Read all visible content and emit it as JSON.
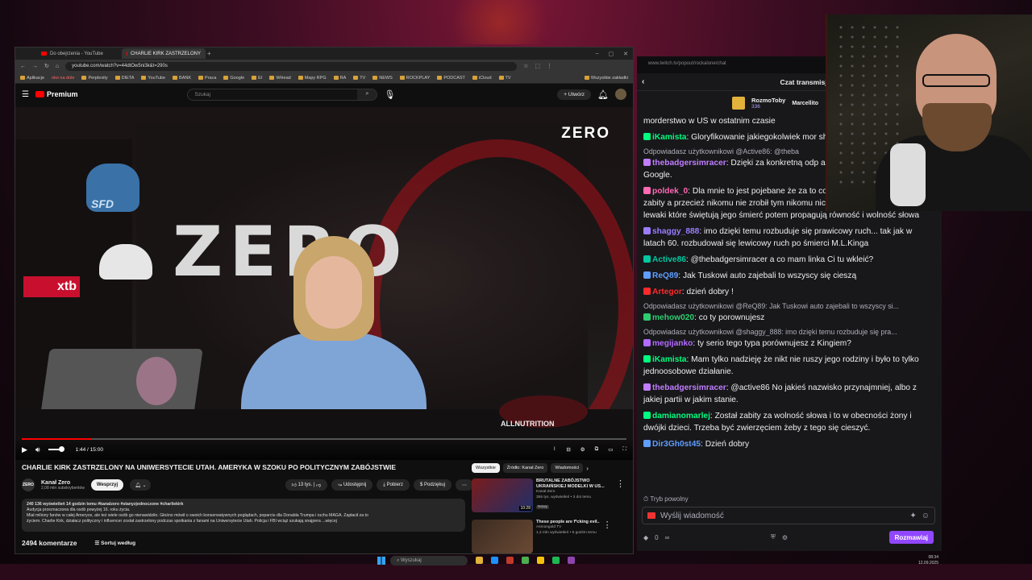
{
  "browser": {
    "tabs": [
      {
        "label": "Do obejrzenia - YouTube",
        "active": false
      },
      {
        "label": "CHARLIE KIRK ZASTRZELONY",
        "active": true
      }
    ],
    "url": "youtube.com/watch?v=44dtOw5ni3k&t=290s",
    "bookmarks": [
      "Aplikacje",
      "oko na dole",
      "Perplexity",
      "DIETA",
      "YouTube",
      "BANK",
      "Praca",
      "Google",
      "EI",
      "WHead",
      "Mapy RPG",
      "RA",
      "TV",
      "NEWS",
      "ROCKPLAY",
      "PODCAST",
      "iCloud",
      "TV"
    ],
    "bookmarks_all": "Wszystkie zakładki"
  },
  "youtube": {
    "brand": "Premium",
    "search_placeholder": "Szukaj",
    "create_label": "Utwórz",
    "video": {
      "time": "1:44 / 15:00",
      "progress_fraction": 0.1156,
      "overlay_logo": "ZERO",
      "sponsor": "xtb",
      "merch": "ALLNUTRITION"
    },
    "title": "CHARLIE KIRK ZASTRZELONY NA UNIWERSYTECIE UTAH. AMERYKA W SZOKU PO POLITYCZNYM ZABÓJSTWIE",
    "channel": {
      "name": "Kanał Zero",
      "subs": "2,08 mln subskrybentów",
      "avatar_text": "ZERO"
    },
    "join_label": "Wesprzyj",
    "actions": {
      "likes": "13 tys.",
      "share": "Udostępnij",
      "download": "Pobierz",
      "thanks": "Podziękuj"
    },
    "description": {
      "stats": "240 136 wyświetleń  14 godzin temu  #kanalzero #stanyzjednoczone #charliekirk",
      "line1": "Audycja przeznaczona dla osób powyżej 16. roku życia.",
      "line2": "Miał miliony fanów w całej Ameryce, ale też wiele osób go nienawidziło. Głośno mówił o swoich konserwatywnych poglądach, poparciu dla Donalda Trumpa i ruchu MAGA. Zapłacił za to",
      "line3": "życiem. Charlie Kirk, działacz polityczny i influencer został zastrzelony podczas spotkania z fanami na Uniwersytecie Utah. Policja i FBI wciąż szukają snajpera  ...więcej"
    },
    "comments_count": "2494 komentarze",
    "sort_label": "Sortuj według",
    "chips": [
      "Wszystkie",
      "Źródło: Kanał Zero",
      "Wiadomości"
    ],
    "recommendations": [
      {
        "title": "BRUTALNE ZABÓJSTWO UKRAIŃSKIEJ MODELKI W US...",
        "channel": "Kanał Zero",
        "meta": "355 tys. wyświetleń • 3 dni temu",
        "badge": "Nowy",
        "duration": "10:28"
      },
      {
        "title": "These people are f*cking evil..",
        "channel": "Asmongold TV",
        "meta": "1,2 mln wyświetleń • 6 godzin temu",
        "badge": "",
        "duration": ""
      }
    ]
  },
  "chat": {
    "url": "www.twitch.tv/popout/rockalone/chat",
    "header": "Czat transmisji",
    "pinned": {
      "name": "RozmoToby",
      "count": "336",
      "second": "Marcellito"
    },
    "messages": [
      {
        "reply": "",
        "user": "",
        "color": "#efeff1",
        "text": "morderstwo w US w ostatnim czasie"
      },
      {
        "reply": "",
        "user": "iKamista",
        "color": "#00ff7f",
        "text": "Gloryfikowanie jakiegokolwiek mor sh."
      },
      {
        "reply": "Odpowiadasz użytkownikowi @Active86: @theba",
        "user": "thebadgersimracer",
        "color": "#c17dff",
        "text": "Dzięki za konkretną odp argument. Wpisz sobie w Google."
      },
      {
        "reply": "",
        "user": "poldek_0",
        "color": "#ff69b4",
        "text": "Dla mnie to jest pojebane że za to co mówił i za to co myśli został zabity a przecież nikomu nie zrobił tym nikomu nic złego. A najlepsze jest to, że lewaki które świętują jego śmierć potem propagują równość i wolność słowa"
      },
      {
        "reply": "",
        "user": "shaggy_888",
        "color": "#9a7dff",
        "text": "imo dzięki temu rozbuduje się prawicowy ruch... tak jak w latach 60. rozbudował się lewicowy ruch po śmierci M.L.Kinga"
      },
      {
        "reply": "",
        "user": "Active86",
        "color": "#00c8a0",
        "text": "@thebadgersimracer a co mam linka Ci tu wkleić?"
      },
      {
        "reply": "",
        "user": "ReQ89",
        "color": "#5f9eff",
        "text": "Jak Tuskowi auto zajebali to wszyscy się cieszą"
      },
      {
        "reply": "",
        "user": "Artegor",
        "color": "#ff2a2a",
        "text": "dzień dobry !"
      },
      {
        "reply": "Odpowiadasz użytkownikowi @ReQ89: Jak Tuskowi auto zajebali to wszyscy si...",
        "user": "mehow020",
        "color": "#2ecc71",
        "text": "co ty porownujesz"
      },
      {
        "reply": "Odpowiadasz użytkownikowi @shaggy_888: imo dzięki temu rozbuduje się pra...",
        "user": "megijanko",
        "color": "#b36bff",
        "text": "ty serio tego typa porównujesz z Kingiem?"
      },
      {
        "reply": "",
        "user": "iKamista",
        "color": "#00ff7f",
        "text": "Mam tylko nadzieję że nikt nie ruszy jego rodziny i było to tylko jednoosobowe działanie."
      },
      {
        "reply": "",
        "user": "thebadgersimracer",
        "color": "#c17dff",
        "text": "@active86 No jakieś nazwisko przynajmniej, albo z jakiej partii w jakim stanie."
      },
      {
        "reply": "",
        "user": "damianomarlej",
        "color": "#00ff7f",
        "text": "Został zabity za wolność słowa i to w obecności żony i dwójki dzieci. Trzeba być zwierzęciem żeby z tego się cieszyć."
      },
      {
        "reply": "",
        "user": "Dir3Gh0st45",
        "color": "#5f9eff",
        "text": "Dzień dobry"
      }
    ],
    "slow_mode": "Tryb powolny",
    "input_placeholder": "Wyślij wiadomość",
    "points": "0",
    "chat_button": "Rozmawiaj"
  },
  "taskbar": {
    "search_placeholder": "Wyszukaj",
    "time": "08:34",
    "date": "12.09.2025"
  }
}
